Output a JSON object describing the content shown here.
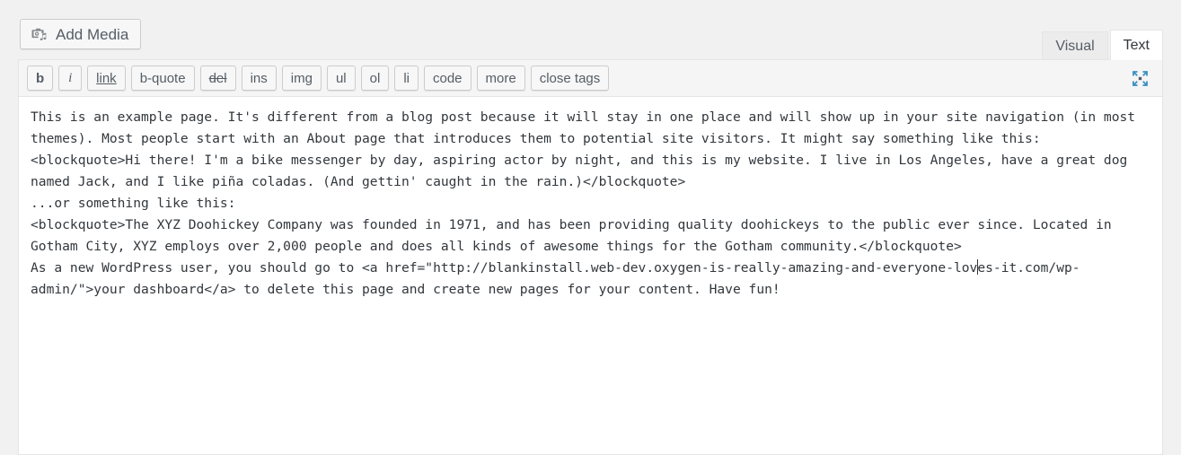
{
  "toolbar": {
    "add_media_label": "Add Media",
    "media_icon": "media-camera-music-icon"
  },
  "editor_tabs": [
    {
      "label": "Visual",
      "active": false
    },
    {
      "label": "Text",
      "active": true
    }
  ],
  "quicktags": [
    {
      "label": "b",
      "style": "bold",
      "name": "quicktag-bold"
    },
    {
      "label": "i",
      "style": "italic",
      "name": "quicktag-italic"
    },
    {
      "label": "link",
      "style": "underline",
      "name": "quicktag-link"
    },
    {
      "label": "b-quote",
      "style": "none",
      "name": "quicktag-blockquote"
    },
    {
      "label": "del",
      "style": "strike",
      "name": "quicktag-del"
    },
    {
      "label": "ins",
      "style": "none",
      "name": "quicktag-ins"
    },
    {
      "label": "img",
      "style": "none",
      "name": "quicktag-img"
    },
    {
      "label": "ul",
      "style": "none",
      "name": "quicktag-ul"
    },
    {
      "label": "ol",
      "style": "none",
      "name": "quicktag-ol"
    },
    {
      "label": "li",
      "style": "none",
      "name": "quicktag-li"
    },
    {
      "label": "code",
      "style": "none",
      "name": "quicktag-code"
    },
    {
      "label": "more",
      "style": "none",
      "name": "quicktag-more"
    },
    {
      "label": "close tags",
      "style": "none",
      "name": "quicktag-close-tags"
    }
  ],
  "fullscreen_button": {
    "icon": "fullscreen-expand-arrows-icon"
  },
  "editor_content": {
    "text_before_caret": "This is an example page. It's different from a blog post because it will stay in one place and will show up in your site navigation (in most themes). Most people start with an About page that introduces them to potential site visitors. It might say something like this:\n<blockquote>Hi there! I'm a bike messenger by day, aspiring actor by night, and this is my website. I live in Los Angeles, have a great dog named Jack, and I like piña coladas. (And gettin' caught in the rain.)</blockquote>\n...or something like this:\n<blockquote>The XYZ Doohickey Company was founded in 1971, and has been providing quality doohickeys to the public ever since. Located in Gotham City, XYZ employs over 2,000 people and does all kinds of awesome things for the Gotham community.</blockquote>\nAs a new WordPress user, you should go to <a href=\"http://blankinstall.web-dev.oxygen-is-really-amazing-and-everyone-lov",
    "text_after_caret": "es-it.com/wp-admin/\">your dashboard</a> to delete this page and create new pages for your content. Have fun!"
  },
  "colors": {
    "page_background": "#f1f1f1",
    "toolbar_background": "#f5f5f5",
    "editor_background": "#ffffff",
    "border": "#e5e5e5",
    "button_border": "#cccccc",
    "text": "#32373c",
    "muted_text": "#555d66",
    "icon_accent": "#3b8ec2"
  }
}
